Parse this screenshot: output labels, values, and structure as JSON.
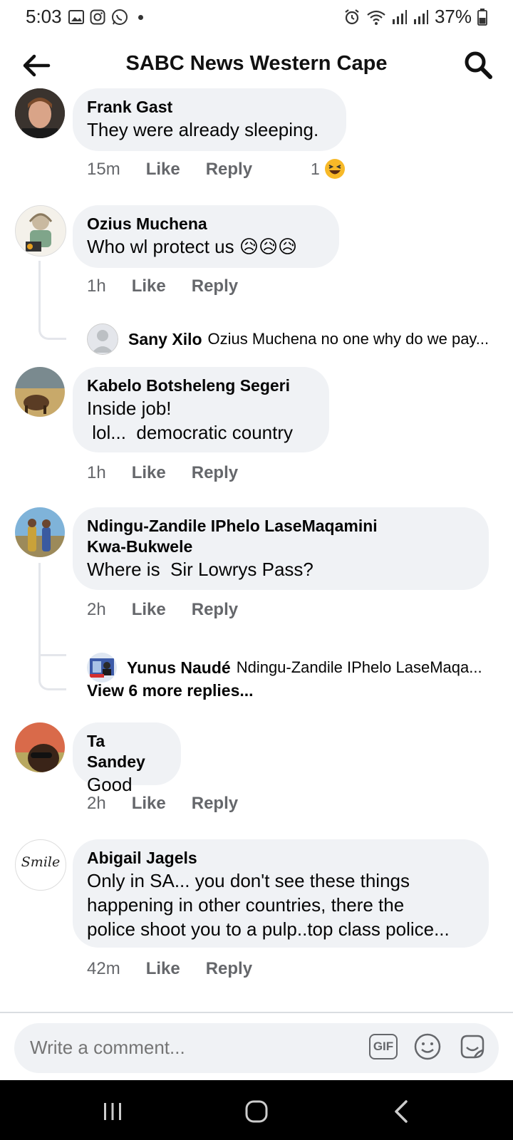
{
  "status_bar": {
    "time": "5:03",
    "battery": "37%"
  },
  "header": {
    "title": "SABC News Western Cape"
  },
  "comments": [
    {
      "name": "Frank Gast",
      "text": "They were already sleeping.",
      "time": "15m",
      "like": "Like",
      "reply": "Reply",
      "reaction_count": "1"
    },
    {
      "name": "Ozius Muchena",
      "text": "Who wl protect us 😥😥😥",
      "time": "1h",
      "like": "Like",
      "reply": "Reply"
    },
    {
      "name": "Kabelo Botsheleng Segeri",
      "text": "Inside job!\n lol...  democratic country",
      "time": "1h",
      "like": "Like",
      "reply": "Reply"
    },
    {
      "name": "Ndingu-Zandile IPhelo LaseMaqamini\nKwa-Bukwele",
      "text": "Where is  Sir Lowrys Pass?",
      "time": "2h",
      "like": "Like",
      "reply": "Reply"
    },
    {
      "name": "Ta Sandey",
      "text": "Good",
      "time": "2h",
      "like": "Like",
      "reply": "Reply"
    },
    {
      "name": "Abigail Jagels",
      "text": "Only in SA... you don't see these things\nhappening in other countries, there the\npolice shoot you to a pulp..top class police...",
      "time": "42m",
      "like": "Like",
      "reply": "Reply"
    }
  ],
  "replies": [
    {
      "name": "Sany Xilo",
      "text": "Ozius Muchena no one why do we pay..."
    },
    {
      "name": "Yunus Naudé",
      "text": "Ndingu-Zandile IPhelo LaseMaqa..."
    }
  ],
  "view_more": "View 6 more replies...",
  "composer": {
    "placeholder": "Write a comment...",
    "gif_label": "GIF"
  },
  "avatar_logo_text": "Smile",
  "colors": {
    "bubble": "#f0f2f5",
    "secondary_text": "#65676b",
    "thread_line": "#e4e6eb"
  }
}
